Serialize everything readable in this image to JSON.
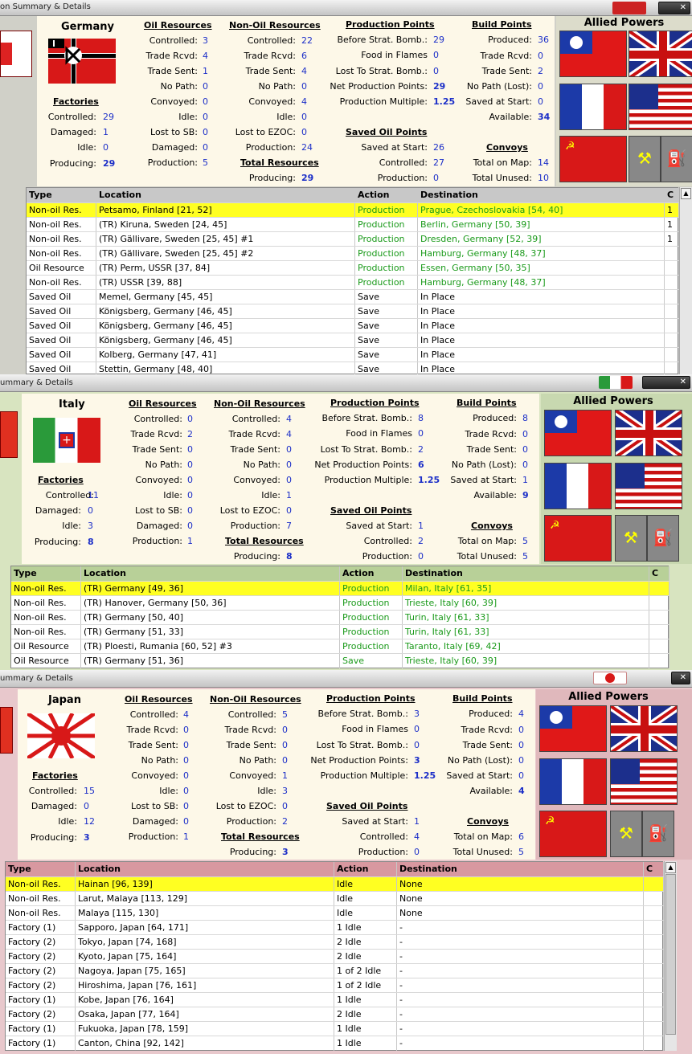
{
  "germany": {
    "title": "on Summary & Details",
    "name": "Germany",
    "oil": {
      "title": "Oil Resources",
      "controlled": "3",
      "trade_rcvd": "4",
      "trade_sent": "1",
      "no_path": "0",
      "convoyed": "0",
      "idle": "0",
      "damaged": "0",
      "production": "5"
    },
    "nonoil": {
      "title": "Non-Oil Resources",
      "controlled": "22",
      "trade_rcvd": "6",
      "trade_sent": "4",
      "no_path": "0",
      "convoyed": "4",
      "idle": "0",
      "lost_ezoc": "0",
      "production": "24"
    },
    "factories": {
      "title": "Factories",
      "controlled": "29",
      "damaged": "1",
      "idle": "0",
      "producing": "29"
    },
    "pp": {
      "title": "Production Points",
      "before_strat": "29",
      "food_flames": "0",
      "lost_strat": "0",
      "net_pp": "29",
      "multiple": "1.25"
    },
    "bp": {
      "title": "Build Points",
      "produced": "36",
      "trade_rcvd": "0",
      "trade_sent": "2",
      "no_path_lost": "0",
      "saved_start": "0",
      "available": "34"
    },
    "saved_oil": {
      "title": "Saved Oil Points",
      "saved_start": "26",
      "controlled": "27",
      "production": "0"
    },
    "convoys": {
      "title": "Convoys",
      "total_map": "14",
      "total_unused": "10"
    },
    "total_res": {
      "title": "Total Resources",
      "producing": "29"
    },
    "rows": [
      {
        "type": "Non-oil Res.",
        "location": "Petsamo, Finland [21, 52]",
        "action": "Production",
        "dest": "Prague, Czechoslovakia [54, 40]",
        "c": "1"
      },
      {
        "type": "Non-oil Res.",
        "location": "(TR) Kiruna, Sweden [24, 45]",
        "action": "Production",
        "dest": "Berlin, Germany [50, 39]",
        "c": "1"
      },
      {
        "type": "Non-oil Res.",
        "location": "(TR) Gällivare, Sweden [25, 45] #1",
        "action": "Production",
        "dest": "Dresden, Germany [52, 39]",
        "c": "1"
      },
      {
        "type": "Non-oil Res.",
        "location": "(TR) Gällivare, Sweden [25, 45] #2",
        "action": "Production",
        "dest": "Hamburg, Germany [48, 37]",
        "c": ""
      },
      {
        "type": "Oil Resource",
        "location": "(TR) Perm, USSR [37, 84]",
        "action": "Production",
        "dest": "Essen, Germany [50, 35]",
        "c": ""
      },
      {
        "type": "Non-oil Res.",
        "location": "(TR) USSR [39, 88]",
        "action": "Production",
        "dest": "Hamburg, Germany [48, 37]",
        "c": ""
      },
      {
        "type": "Saved Oil",
        "location": "Memel, Germany [45, 45]",
        "action": "Save",
        "dest": "In Place",
        "c": ""
      },
      {
        "type": "Saved Oil",
        "location": "Königsberg, Germany [46, 45]",
        "action": "Save",
        "dest": "In Place",
        "c": ""
      },
      {
        "type": "Saved Oil",
        "location": "Königsberg, Germany [46, 45]",
        "action": "Save",
        "dest": "In Place",
        "c": ""
      },
      {
        "type": "Saved Oil",
        "location": "Königsberg, Germany [46, 45]",
        "action": "Save",
        "dest": "In Place",
        "c": ""
      },
      {
        "type": "Saved Oil",
        "location": "Kolberg, Germany [47, 41]",
        "action": "Save",
        "dest": "In Place",
        "c": ""
      },
      {
        "type": "Saved Oil",
        "location": "Stettin, Germany [48, 40]",
        "action": "Save",
        "dest": "In Place",
        "c": ""
      }
    ]
  },
  "italy": {
    "title": "ummary & Details",
    "name": "Italy",
    "oil": {
      "title": "Oil Resources",
      "controlled": "0",
      "trade_rcvd": "2",
      "trade_sent": "0",
      "no_path": "0",
      "convoyed": "0",
      "idle": "0",
      "damaged": "0",
      "production": "1"
    },
    "nonoil": {
      "title": "Non-Oil Resources",
      "controlled": "4",
      "trade_rcvd": "4",
      "trade_sent": "0",
      "no_path": "0",
      "convoyed": "0",
      "idle": "1",
      "lost_ezoc": "0",
      "production": "7"
    },
    "factories": {
      "title": "Factories",
      "controlled": "11",
      "damaged": "0",
      "idle": "3",
      "producing": "8"
    },
    "pp": {
      "title": "Production Points",
      "before_strat": "8",
      "food_flames": "0",
      "lost_strat": "2",
      "net_pp": "6",
      "multiple": "1.25"
    },
    "bp": {
      "title": "Build Points",
      "produced": "8",
      "trade_rcvd": "0",
      "trade_sent": "0",
      "no_path_lost": "0",
      "saved_start": "1",
      "available": "9"
    },
    "saved_oil": {
      "title": "Saved Oil Points",
      "saved_start": "1",
      "controlled": "2",
      "production": "0"
    },
    "convoys": {
      "title": "Convoys",
      "total_map": "5",
      "total_unused": "5"
    },
    "total_res": {
      "title": "Total Resources",
      "producing": "8"
    },
    "rows": [
      {
        "type": "Non-oil Res.",
        "location": "(TR) Germany [49, 36]",
        "action": "Production",
        "dest": "Milan, Italy [61, 35]",
        "c": ""
      },
      {
        "type": "Non-oil Res.",
        "location": "(TR) Hanover, Germany [50, 36]",
        "action": "Production",
        "dest": "Trieste, Italy [60, 39]",
        "c": ""
      },
      {
        "type": "Non-oil Res.",
        "location": "(TR) Germany [50, 40]",
        "action": "Production",
        "dest": "Turin, Italy [61, 33]",
        "c": ""
      },
      {
        "type": "Non-oil Res.",
        "location": "(TR) Germany [51, 33]",
        "action": "Production",
        "dest": "Turin, Italy [61, 33]",
        "c": ""
      },
      {
        "type": "Oil Resource",
        "location": "(TR) Ploesti, Rumania [60, 52] #3",
        "action": "Production",
        "dest": "Taranto, Italy [69, 42]",
        "c": ""
      },
      {
        "type": "Oil Resource",
        "location": "(TR) Germany [51, 36]",
        "action": "Save",
        "dest": "Trieste, Italy [60, 39]",
        "c": ""
      }
    ]
  },
  "japan": {
    "title": "ummary & Details",
    "name": "Japan",
    "oil": {
      "title": "Oil Resources",
      "controlled": "4",
      "trade_rcvd": "0",
      "trade_sent": "0",
      "no_path": "0",
      "convoyed": "0",
      "idle": "0",
      "damaged": "0",
      "production": "1"
    },
    "nonoil": {
      "title": "Non-Oil Resources",
      "controlled": "5",
      "trade_rcvd": "0",
      "trade_sent": "0",
      "no_path": "0",
      "convoyed": "1",
      "idle": "3",
      "lost_ezoc": "0",
      "production": "2"
    },
    "factories": {
      "title": "Factories",
      "controlled": "15",
      "damaged": "0",
      "idle": "12",
      "producing": "3"
    },
    "pp": {
      "title": "Production Points",
      "before_strat": "3",
      "food_flames": "0",
      "lost_strat": "0",
      "net_pp": "3",
      "multiple": "1.25"
    },
    "bp": {
      "title": "Build Points",
      "produced": "4",
      "trade_rcvd": "0",
      "trade_sent": "0",
      "no_path_lost": "0",
      "saved_start": "0",
      "available": "4"
    },
    "saved_oil": {
      "title": "Saved Oil Points",
      "saved_start": "1",
      "controlled": "4",
      "production": "0"
    },
    "convoys": {
      "title": "Convoys",
      "total_map": "6",
      "total_unused": "5"
    },
    "total_res": {
      "title": "Total Resources",
      "producing": "3"
    },
    "rows": [
      {
        "type": "Non-oil Res.",
        "location": "Hainan [96, 139]",
        "action": "Idle",
        "dest": "None",
        "c": ""
      },
      {
        "type": "Non-oil Res.",
        "location": "Larut, Malaya [113, 129]",
        "action": "Idle",
        "dest": "None",
        "c": ""
      },
      {
        "type": "Non-oil Res.",
        "location": "Malaya [115, 130]",
        "action": "Idle",
        "dest": "None",
        "c": ""
      },
      {
        "type": "Factory (1)",
        "location": "Sapporo, Japan [64, 171]",
        "action": "1 Idle",
        "dest": "-",
        "c": ""
      },
      {
        "type": "Factory (2)",
        "location": "Tokyo, Japan [74, 168]",
        "action": "2 Idle",
        "dest": "-",
        "c": ""
      },
      {
        "type": "Factory (2)",
        "location": "Kyoto, Japan [75, 164]",
        "action": "2 Idle",
        "dest": "-",
        "c": ""
      },
      {
        "type": "Factory (2)",
        "location": "Nagoya, Japan [75, 165]",
        "action": "1 of 2 Idle",
        "dest": "-",
        "c": ""
      },
      {
        "type": "Factory (2)",
        "location": "Hiroshima, Japan [76, 161]",
        "action": "1 of 2 Idle",
        "dest": "-",
        "c": ""
      },
      {
        "type": "Factory (1)",
        "location": "Kobe, Japan [76, 164]",
        "action": "1 Idle",
        "dest": "-",
        "c": ""
      },
      {
        "type": "Factory (2)",
        "location": "Osaka, Japan [77, 164]",
        "action": "2 Idle",
        "dest": "-",
        "c": ""
      },
      {
        "type": "Factory (1)",
        "location": "Fukuoka, Japan [78, 159]",
        "action": "1 Idle",
        "dest": "-",
        "c": ""
      },
      {
        "type": "Factory (1)",
        "location": "Canton, China [92, 142]",
        "action": "1 Idle",
        "dest": "-",
        "c": ""
      }
    ]
  },
  "labels": {
    "controlled": "Controlled:",
    "trade_rcvd": "Trade Rcvd:",
    "trade_sent": "Trade Sent:",
    "no_path": "No Path:",
    "convoyed": "Convoyed:",
    "idle": "Idle:",
    "damaged": "Damaged:",
    "production": "Production:",
    "lost_sb": "Lost to SB:",
    "lost_ezoc": "Lost to EZOC:",
    "producing": "Producing:",
    "before_strat": "Before Strat. Bomb.:",
    "food_flames": "Food in Flames",
    "lost_strat": "Lost To Strat. Bomb.:",
    "net_pp": "Net Production Points:",
    "multiple": "Production Multiple:",
    "produced": "Produced:",
    "no_path_lost": "No Path (Lost):",
    "saved_start": "Saved at Start:",
    "available": "Available:",
    "total_map": "Total on Map:",
    "total_unused": "Total Unused:",
    "col_type": "Type",
    "col_location": "Location",
    "col_action": "Action",
    "col_dest": "Destination",
    "col_c": "C",
    "allied": "Allied Powers"
  },
  "colors": {
    "germany_header": "#c8c8c8",
    "italy_header": "#b8d098",
    "japan_header": "#d898a0",
    "italy_bg": "#d8e4c0",
    "japan_bg": "#e8c8cc",
    "selected": "#ffff22",
    "green_text": "#1a9a1a",
    "value_blue": "#1c2fc8"
  }
}
